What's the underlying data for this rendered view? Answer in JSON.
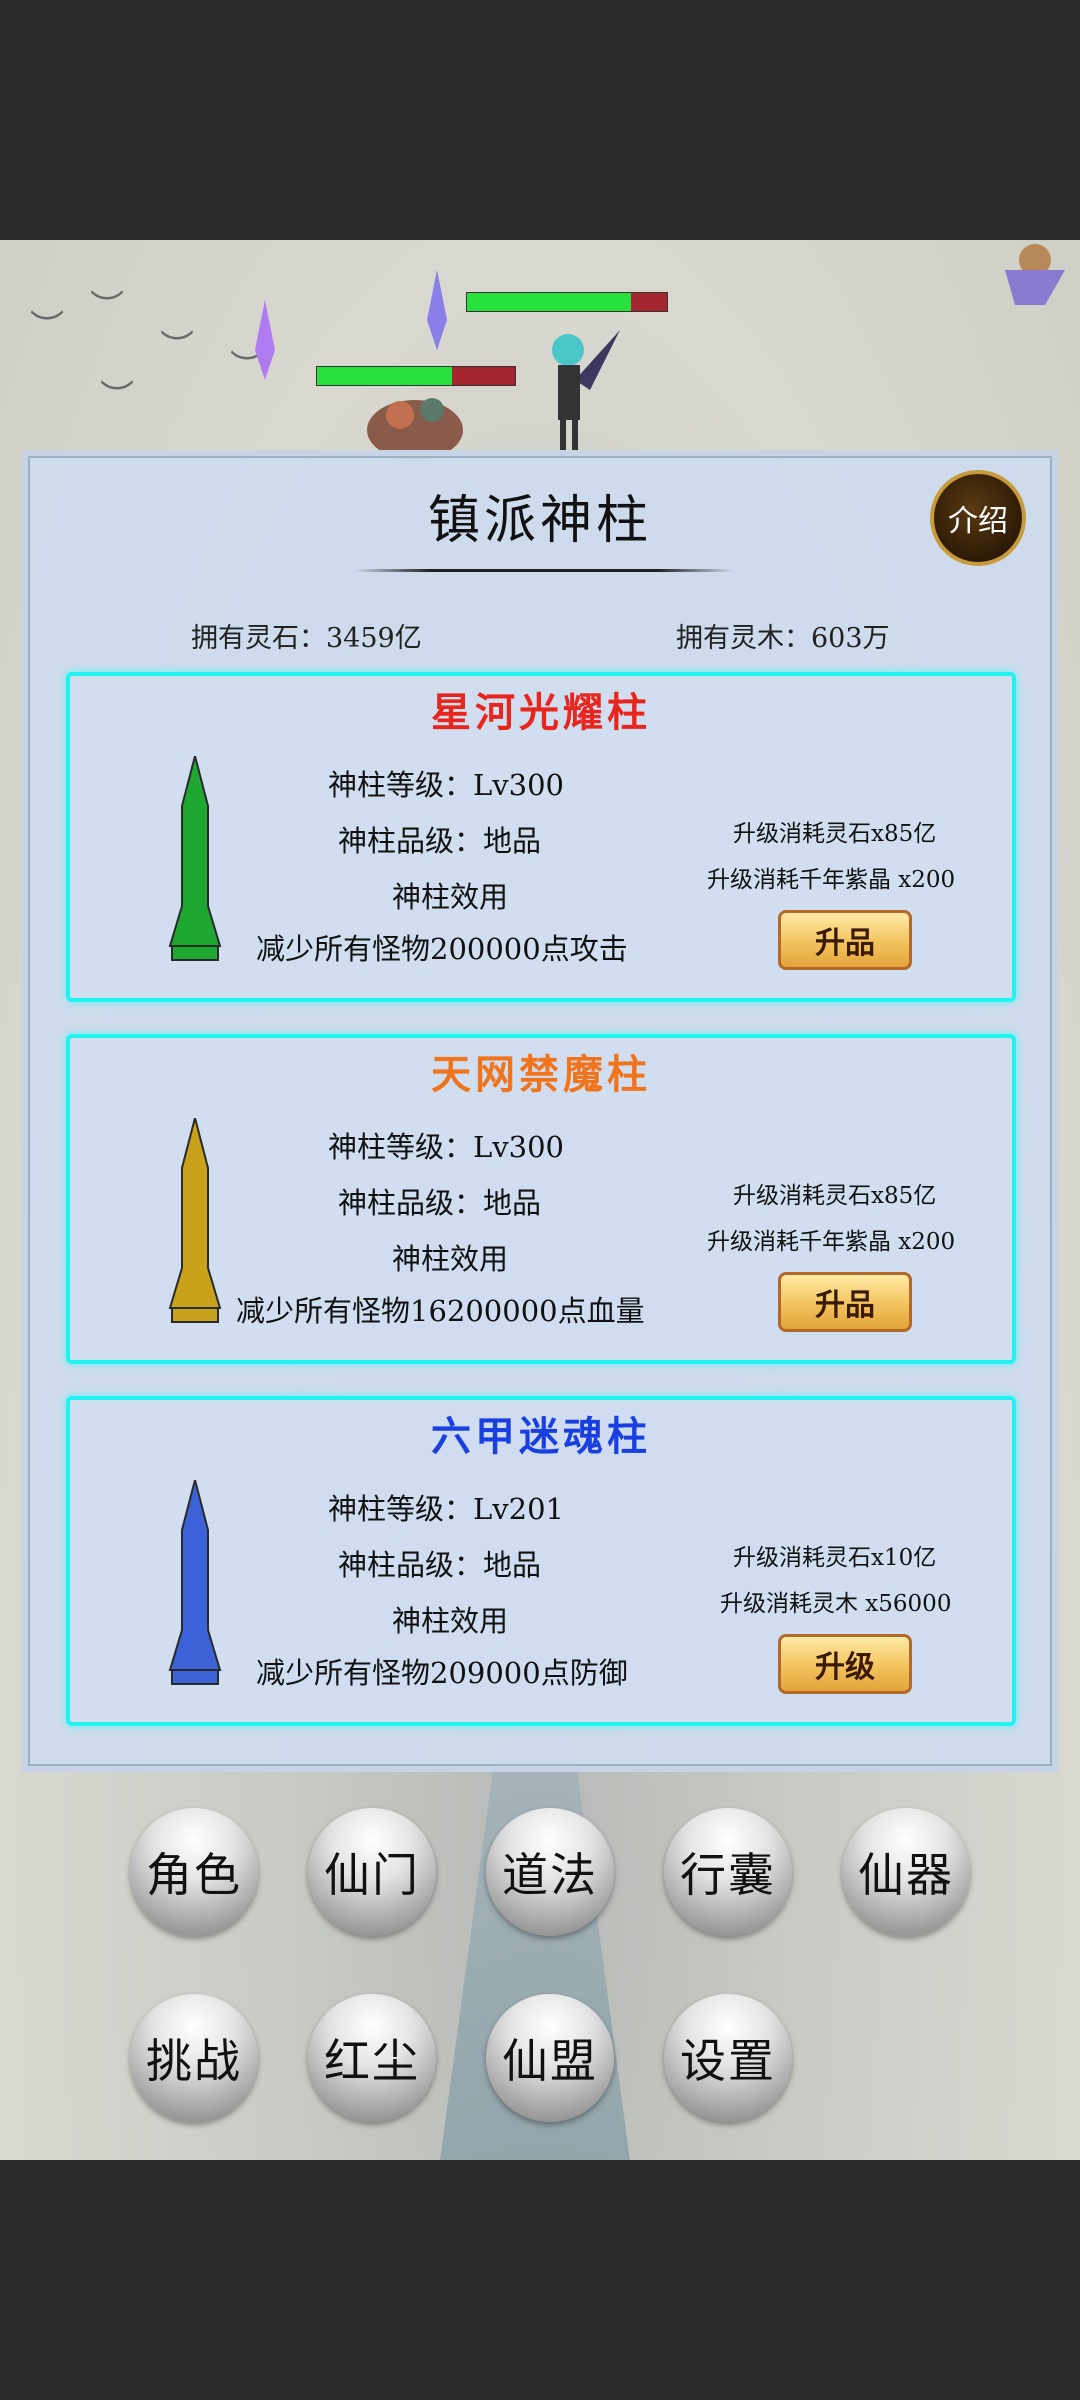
{
  "panel": {
    "title": "镇派神柱",
    "intro_button": "介绍",
    "spirit_stone": "拥有灵石：3459亿",
    "spirit_wood": "拥有灵木：603万"
  },
  "pillars": [
    {
      "name": "星河光耀柱",
      "name_color": "#e8261e",
      "level": "神柱等级：Lv300",
      "grade": "神柱品级：地品",
      "effect_title": "神柱效用",
      "effect": "减少所有怪物200000点攻击",
      "cost1": "升级消耗灵石x85亿",
      "cost2": "升级消耗千年紫晶 x200",
      "button": "升品",
      "color": "#1ea832"
    },
    {
      "name": "天网禁魔柱",
      "name_color": "#f0741c",
      "level": "神柱等级：Lv300",
      "grade": "神柱品级：地品",
      "effect_title": "神柱效用",
      "effect": "减少所有怪物16200000点血量",
      "cost1": "升级消耗灵石x85亿",
      "cost2": "升级消耗千年紫晶 x200",
      "button": "升品",
      "color": "#c8a21a"
    },
    {
      "name": "六甲迷魂柱",
      "name_color": "#1a3fe0",
      "level": "神柱等级：Lv201",
      "grade": "神柱品级：地品",
      "effect_title": "神柱效用",
      "effect": "减少所有怪物209000点防御",
      "cost1": "升级消耗灵石x10亿",
      "cost2": "升级消耗灵木 x56000",
      "button": "升级",
      "color": "#3c62d8"
    }
  ],
  "menu": [
    "角色",
    "仙门",
    "道法",
    "行囊",
    "仙器",
    "挑战",
    "红尘",
    "仙盟",
    "设置"
  ],
  "hp_bars": [
    {
      "fraction": 0.82
    },
    {
      "fraction": 0.68
    }
  ]
}
